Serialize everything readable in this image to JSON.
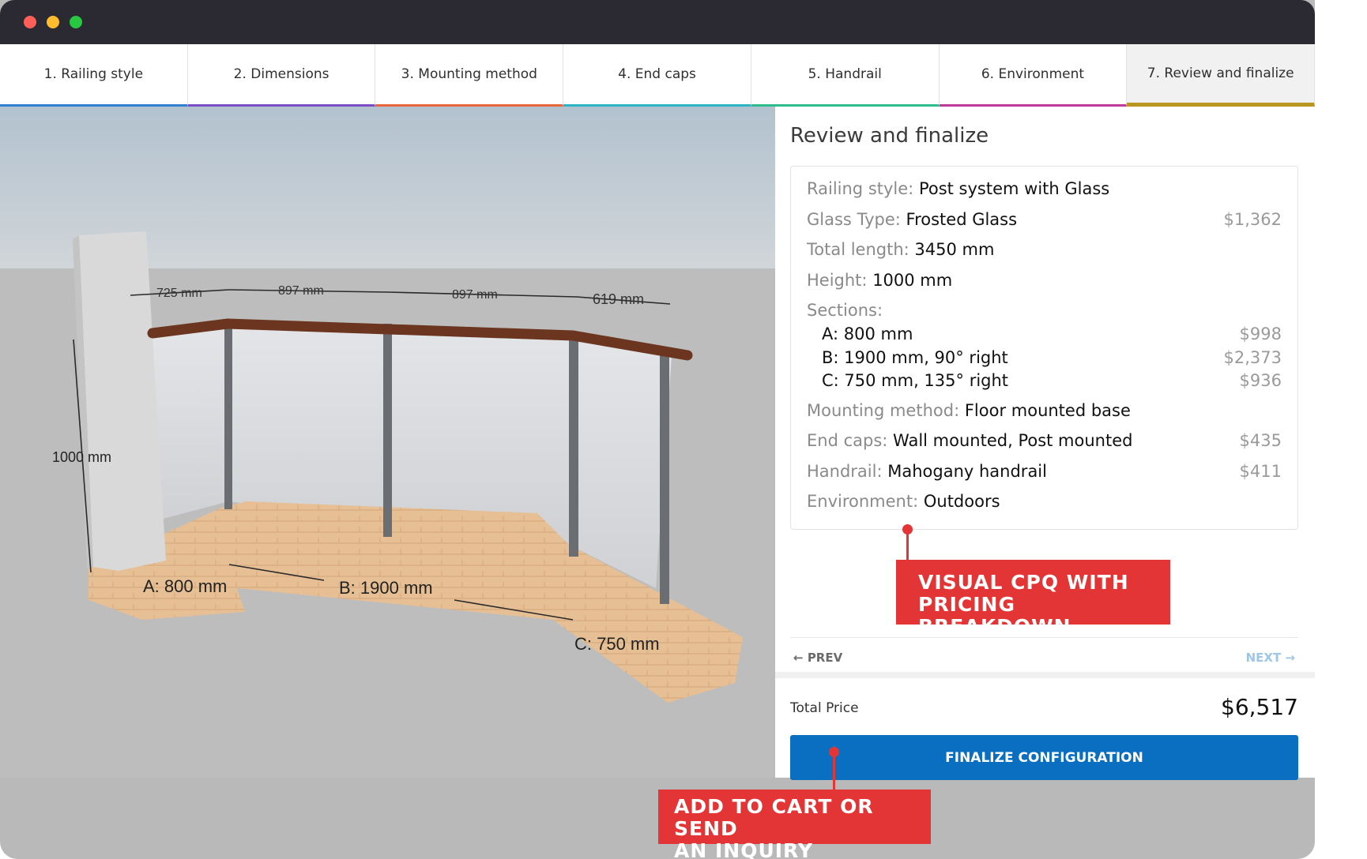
{
  "tabs": [
    {
      "label": "1. Railing style",
      "color": "#2f7fd3"
    },
    {
      "label": "2. Dimensions",
      "color": "#7a4fc6"
    },
    {
      "label": "3. Mounting method",
      "color": "#e8673c"
    },
    {
      "label": "4. End caps",
      "color": "#2bb4c4"
    },
    {
      "label": "5. Handrail",
      "color": "#2ebc8d"
    },
    {
      "label": "6. Environment",
      "color": "#c1399a"
    },
    {
      "label": "7. Review and finalize",
      "color": "#b8961f"
    }
  ],
  "scene": {
    "dimensions_top": [
      "725 mm",
      "897 mm",
      "897 mm",
      "619 mm"
    ],
    "height_label": "1000 mm",
    "section_labels": [
      "A: 800 mm",
      "B: 1900 mm",
      "C: 750 mm"
    ]
  },
  "review": {
    "title": "Review and finalize",
    "railing_style_key": "Railing style:",
    "railing_style_val": "Post system with Glass",
    "glass_type_key": "Glass Type:",
    "glass_type_val": "Frosted Glass",
    "glass_type_price": "$1,362",
    "total_length_key": "Total length:",
    "total_length_val": "3450 mm",
    "height_key": "Height:",
    "height_val": "1000 mm",
    "sections_key": "Sections:",
    "sections": [
      {
        "label": "A: 800 mm",
        "price": "$998"
      },
      {
        "label": "B: 1900 mm, 90° right",
        "price": "$2,373"
      },
      {
        "label": "C: 750 mm, 135° right",
        "price": "$936"
      }
    ],
    "mounting_key": "Mounting method:",
    "mounting_val": "Floor mounted base",
    "endcaps_key": "End caps:",
    "endcaps_val": "Wall mounted, Post mounted",
    "endcaps_price": "$435",
    "handrail_key": "Handrail:",
    "handrail_val": "Mahogany handrail",
    "handrail_price": "$411",
    "environment_key": "Environment:",
    "environment_val": "Outdoors"
  },
  "nav": {
    "prev": "PREV",
    "next": "NEXT"
  },
  "total": {
    "label": "Total Price",
    "value": "$6,517"
  },
  "finalize_label": "FINALIZE CONFIGURATION",
  "callouts": {
    "cpq": "VISUAL CPQ WITH\nPRICING BREAKDOWN",
    "cart": "ADD TO CART OR SEND\nAN INQUIRY OPTIONS"
  },
  "colors": {
    "accent": "#0a6ec1",
    "callout": "#e33535"
  }
}
